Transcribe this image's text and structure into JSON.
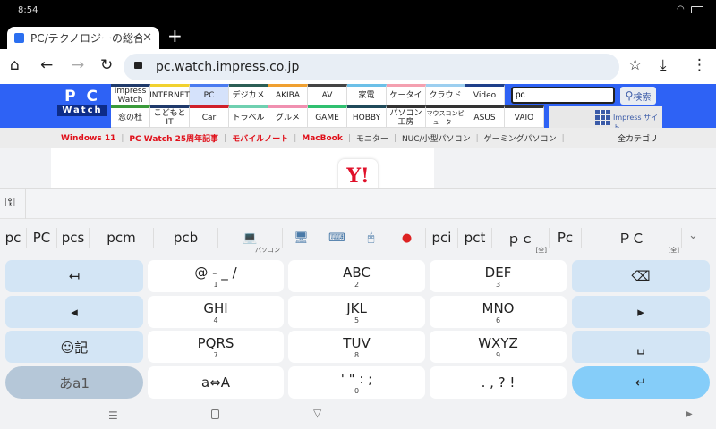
{
  "status": {
    "time": "8:54"
  },
  "browser": {
    "tab_title": "PC/テクノロジーの総合情報",
    "url": "pc.watch.impress.co.jp"
  },
  "site": {
    "logo_top": "P C",
    "logo_bottom": "Watch",
    "nav_top": [
      {
        "label": "Impress Watch",
        "color": "#1f3a6b"
      },
      {
        "label": "INTERNET",
        "color": "#f2d22e"
      },
      {
        "label": "PC",
        "color": "#4a7bf0",
        "active": true
      },
      {
        "label": "デジカメ",
        "color": "#2b5e55"
      },
      {
        "label": "AKIBA",
        "color": "#f0a030"
      },
      {
        "label": "AV",
        "color": "#444444"
      },
      {
        "label": "家電",
        "color": "#6cc0e8"
      },
      {
        "label": "ケータイ",
        "color": "#f4a0b0"
      },
      {
        "label": "クラウド",
        "color": "#9ccff0"
      },
      {
        "label": "Video",
        "color": "#1e3f8a"
      }
    ],
    "nav_bottom": [
      {
        "label": "窓の杜",
        "color": "#3a9a3a"
      },
      {
        "label": "こどもとIT",
        "color": "#1f3a6b"
      },
      {
        "label": "Car",
        "color": "#d0202a"
      },
      {
        "label": "トラベル",
        "color": "#6fd0b0"
      },
      {
        "label": "グルメ",
        "color": "#f090b0"
      },
      {
        "label": "GAME",
        "color": "#30c070"
      },
      {
        "label": "HOBBY",
        "color": "#1f4a5a"
      },
      {
        "label": "パソコン工房",
        "color": "#333333"
      },
      {
        "label": "マウスコンピューター",
        "color": "#333333"
      },
      {
        "label": "ASUS",
        "color": "#333333"
      },
      {
        "label": "VAIO",
        "color": "#333333"
      }
    ],
    "search_value": "pc",
    "search_button": "検索",
    "impress_sites": "Impress サイト",
    "categories": [
      {
        "label": "Windows 11",
        "red": true
      },
      {
        "label": "PC Watch 25周年記事",
        "red": true
      },
      {
        "label": "モバイルノート",
        "red": true
      },
      {
        "label": "MacBook",
        "red": true
      },
      {
        "label": "モニター"
      },
      {
        "label": "NUC/小型パソコン"
      },
      {
        "label": "ゲーミングパソコン"
      }
    ],
    "all_categories": "全カテゴリ",
    "yahoo": "Y!"
  },
  "keyboard": {
    "candidates": [
      {
        "t": "pc"
      },
      {
        "t": "PC"
      },
      {
        "t": "pcs"
      },
      {
        "t": "pcm"
      },
      {
        "t": "pcb"
      },
      {
        "t": "💻",
        "s": "パソコン",
        "icon": "laptop-icon"
      },
      {
        "t": "🖥",
        "icon": "monitor-icon"
      },
      {
        "t": "⌨",
        "icon": "keyboard-icon"
      },
      {
        "t": "🖱",
        "icon": "mouse-icon"
      },
      {
        "t": "●",
        "icon": "trackball-icon"
      },
      {
        "t": "pci"
      },
      {
        "t": "pct"
      },
      {
        "t": "ｐｃ",
        "s": "[全]"
      },
      {
        "t": "Pc"
      },
      {
        "t": "ＰＣ",
        "s": "[全]"
      }
    ],
    "keys": [
      [
        "↤",
        {
          "l": "@ - _ /",
          "n": "1"
        },
        {
          "l": "ABC",
          "n": "2"
        },
        {
          "l": "DEF",
          "n": "3"
        },
        "⌫"
      ],
      [
        "◂",
        {
          "l": "GHI",
          "n": "4"
        },
        {
          "l": "JKL",
          "n": "5"
        },
        {
          "l": "MNO",
          "n": "6"
        },
        "▸"
      ],
      [
        "☺記",
        {
          "l": "PQRS",
          "n": "7"
        },
        {
          "l": "TUV",
          "n": "8"
        },
        {
          "l": "WXYZ",
          "n": "9"
        },
        "␣"
      ],
      [
        "あa1",
        {
          "l": "a⇔A",
          "n": ""
        },
        {
          "l": "' \" : ;",
          "n": "0"
        },
        {
          "l": ". , ? !",
          "n": ""
        },
        "↵"
      ]
    ],
    "accent": "#85cdf9",
    "fn_color": "#d3e5f5",
    "mode_color": "#b5c7d8"
  }
}
